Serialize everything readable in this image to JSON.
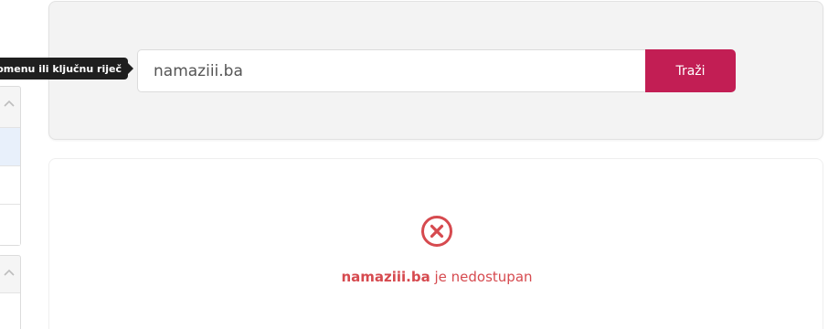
{
  "search": {
    "value": "namaziii.ba",
    "button_label": "Traži"
  },
  "tooltip": {
    "text": "te domenu ili ključnu riječ"
  },
  "result": {
    "domain": "namaziii.ba",
    "status_text": " je nedostupan"
  },
  "colors": {
    "accent": "#c21e54",
    "error": "#d64a4f",
    "card_bg": "#f3f3f3"
  },
  "icons": {
    "result": "x-circle-icon",
    "sidebar_toggle": "chevron-up-icon"
  }
}
